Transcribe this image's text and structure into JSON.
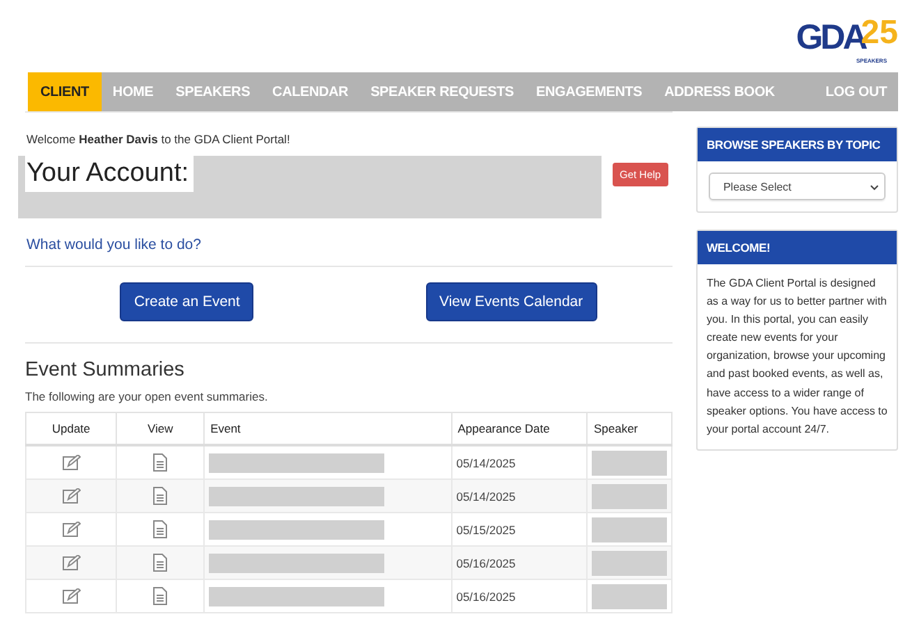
{
  "logo": {
    "letters": "GDA",
    "number": "25",
    "tagline": "SPEAKERS"
  },
  "nav": {
    "items": [
      {
        "label": "CLIENT",
        "selected": true
      },
      {
        "label": "HOME",
        "selected": false
      },
      {
        "label": "SPEAKERS",
        "selected": false
      },
      {
        "label": "CALENDAR",
        "selected": false
      },
      {
        "label": "SPEAKER REQUESTS",
        "selected": false
      },
      {
        "label": "ENGAGEMENTS",
        "selected": false
      },
      {
        "label": "ADDRESS BOOK",
        "selected": false
      }
    ],
    "logout": "LOG OUT"
  },
  "welcome": "Welcome **Heather Davis** to the GDA Client Portal!",
  "account": {
    "label": "Your Account:",
    "help_button": "Get Help"
  },
  "prompt": "What would you like to do?",
  "actions": [
    "Create an Event",
    "View Events Calendar"
  ],
  "events": {
    "title": "Event Summaries",
    "subtitle": "The following are your open event summaries.",
    "columns": [
      "Update",
      "View",
      "Event",
      "Appearance Date",
      "Speaker"
    ],
    "rows": [
      {
        "date": "05/14/2025"
      },
      {
        "date": "05/14/2025"
      },
      {
        "date": "05/15/2025"
      },
      {
        "date": "05/16/2025"
      },
      {
        "date": "05/16/2025"
      }
    ]
  },
  "sidebar": {
    "topic_title": "BROWSE SPEAKERS BY TOPIC",
    "topic_placeholder": "Please Select",
    "welcome_title": "WELCOME!",
    "welcome_text": "The GDA Client Portal is designed as a way for us to better partner with you. In this portal, you can easily create new events for your organization, browse your upcoming and past booked events, as well as, have access to a wider range of speaker options. You have access to your portal account 24/7."
  }
}
